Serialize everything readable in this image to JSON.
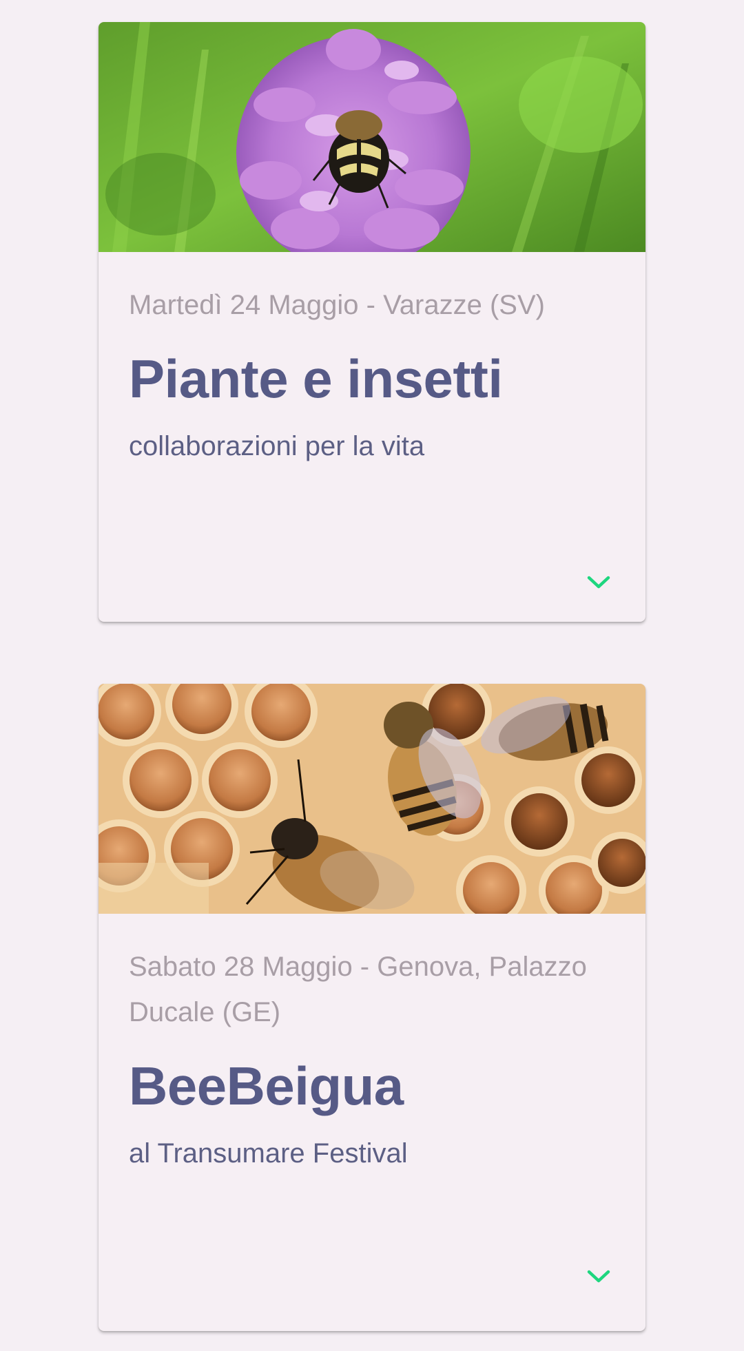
{
  "events": [
    {
      "date": "Martedì 24 Maggio - Varazze (SV)",
      "title": "Piante e insetti",
      "subtitle": "collaborazioni per la vita",
      "image": "orchid-with-beetle-photo",
      "expand_icon": "chevron-down-icon"
    },
    {
      "date": "Sabato 28 Maggio - Genova, Palazzo Ducale (GE)",
      "title": "BeeBeigua",
      "subtitle": "al Transumare Festival",
      "image": "honeybees-on-honeycomb-photo",
      "expand_icon": "chevron-down-icon"
    }
  ],
  "colors": {
    "background": "#f5eff4",
    "title": "#565a86",
    "date": "#a89ea6",
    "accent": "#1ed67f"
  }
}
